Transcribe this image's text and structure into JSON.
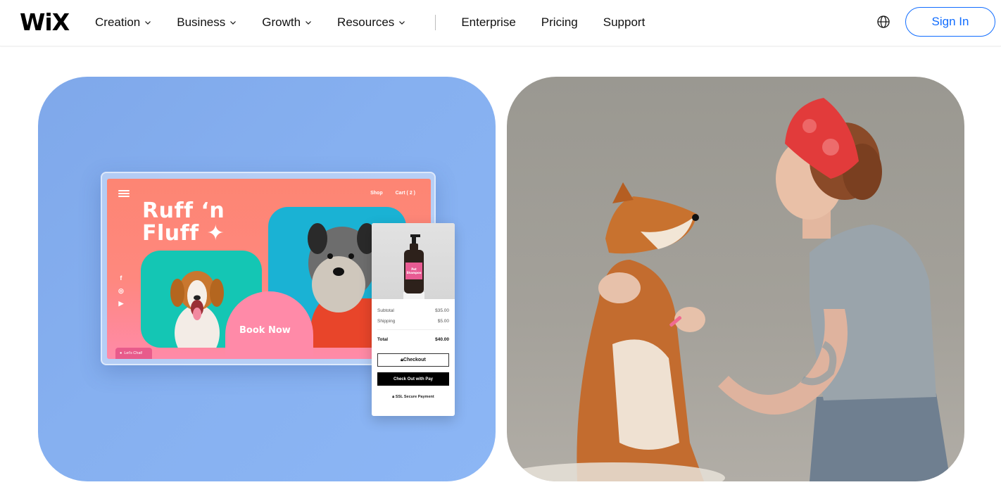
{
  "header": {
    "logo": "WiX",
    "nav": [
      {
        "label": "Creation",
        "has_dropdown": true
      },
      {
        "label": "Business",
        "has_dropdown": true
      },
      {
        "label": "Growth",
        "has_dropdown": true
      },
      {
        "label": "Resources",
        "has_dropdown": true
      }
    ],
    "nav_secondary": [
      {
        "label": "Enterprise"
      },
      {
        "label": "Pricing"
      },
      {
        "label": "Support"
      }
    ],
    "language_icon": "globe-icon",
    "sign_in_label": "Sign In",
    "accent_color": "#116dff"
  },
  "showcase": {
    "left_card": {
      "background": "#86b0f0",
      "mockup": {
        "title_line1": "Ruff ‘n",
        "title_line2": "Fluff ✦",
        "links": [
          "Shop",
          "Cart ( 2 )"
        ],
        "social": [
          "f",
          "◎",
          "▶"
        ],
        "cta": "Book Now",
        "chat_label": "Let's Chat!"
      },
      "checkout": {
        "product_label_line1": "Pet",
        "product_label_line2": "Shampoo",
        "rows": [
          {
            "label": "Subtotal",
            "value": "$35.00"
          },
          {
            "label": "Shipping",
            "value": "$5.00"
          }
        ],
        "total_label": "Total",
        "total_value": "$40.00",
        "checkout_button": "Checkout",
        "pay_button": "Check Out with  Pay",
        "secure_text": "SSL Secure Payment"
      }
    },
    "right_card": {
      "image_description": "Woman in red headband grooming a Shiba Inu dog with a brush"
    }
  }
}
